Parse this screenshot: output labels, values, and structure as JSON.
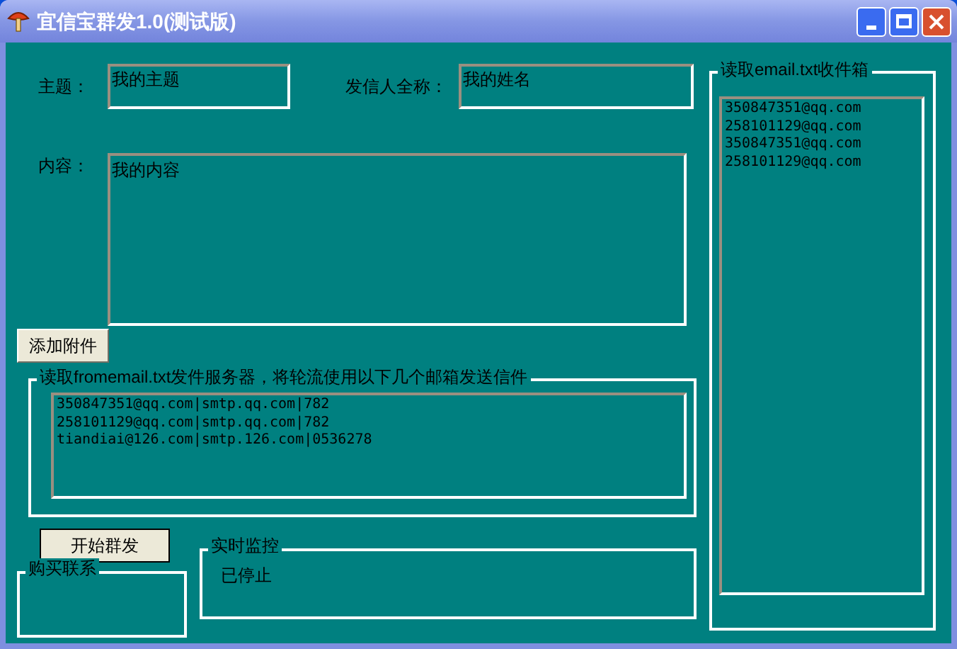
{
  "window": {
    "title": "宜信宝群发1.0(测试版)"
  },
  "subject": {
    "label": "主题：",
    "value": "我的主题"
  },
  "sender": {
    "label": "发信人全称：",
    "value": "我的姓名"
  },
  "content": {
    "label": "内容：",
    "value": "我的内容"
  },
  "attach_button": "添加附件",
  "servers": {
    "title": "读取fromemail.txt发件服务器，将轮流使用以下几个邮箱发送信件",
    "lines": [
      "350847351@qq.com|smtp.qq.com|782",
      "258101129@qq.com|smtp.qq.com|782",
      "tiandiai@126.com|smtp.126.com|0536278"
    ]
  },
  "start_button": "开始群发",
  "contact": {
    "title": "购买联系"
  },
  "monitor": {
    "title": "实时监控",
    "status": "已停止"
  },
  "recipients": {
    "title": "读取email.txt收件箱",
    "lines": [
      "350847351@qq.com",
      "258101129@qq.com",
      "350847351@qq.com",
      "258101129@qq.com"
    ]
  }
}
